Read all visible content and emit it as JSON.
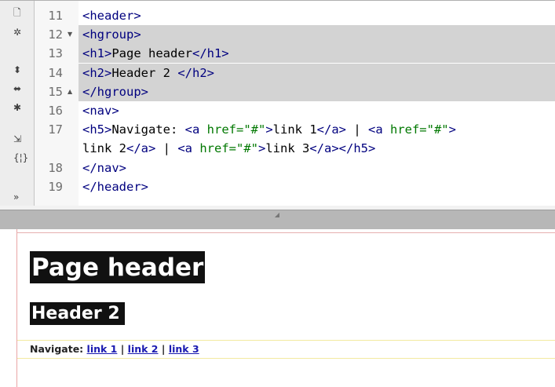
{
  "toolbar": {
    "icons": [
      "new-document-icon",
      "bug-icon",
      "collapse-tag-icon",
      "collapse-selection-icon",
      "expand-all-icon",
      "select-parent-tag-icon",
      "balance-braces-icon",
      "more-tools-icon"
    ],
    "glyphs": [
      "🗋",
      "✲",
      "⬍",
      "⬌",
      "✱",
      "⇲",
      "{¦}",
      "»"
    ]
  },
  "code_lines": [
    {
      "num": "11",
      "fold": "",
      "highlight": false,
      "parts": [
        {
          "t": "tag",
          "s": "<header>"
        }
      ]
    },
    {
      "num": "12",
      "fold": "▼",
      "highlight": true,
      "parts": [
        {
          "t": "tag",
          "s": "<hgroup>"
        }
      ]
    },
    {
      "num": "13",
      "fold": "",
      "highlight": true,
      "parts": [
        {
          "t": "tag",
          "s": "<h1>"
        },
        {
          "t": "txt",
          "s": "Page header"
        },
        {
          "t": "tag",
          "s": "</h1>"
        }
      ]
    },
    {
      "num": "14",
      "fold": "",
      "highlight": true,
      "parts": [
        {
          "t": "tag",
          "s": "<h2>"
        },
        {
          "t": "txt",
          "s": "Header 2 "
        },
        {
          "t": "tag",
          "s": "</h2>"
        }
      ]
    },
    {
      "num": "15",
      "fold": "▲",
      "highlight": true,
      "parts": [
        {
          "t": "tag",
          "s": "</hgroup>"
        }
      ]
    },
    {
      "num": "16",
      "fold": "",
      "highlight": false,
      "parts": [
        {
          "t": "tag",
          "s": "<nav>"
        }
      ]
    },
    {
      "num": "17",
      "fold": "",
      "highlight": false,
      "parts": [
        {
          "t": "tag",
          "s": "<h5>"
        },
        {
          "t": "txt",
          "s": "Navigate: "
        },
        {
          "t": "tag",
          "s": "<a "
        },
        {
          "t": "attr",
          "s": "href=\"#\""
        },
        {
          "t": "tag",
          "s": ">"
        },
        {
          "t": "txt",
          "s": "link 1"
        },
        {
          "t": "tag",
          "s": "</a>"
        },
        {
          "t": "txt",
          "s": " | "
        },
        {
          "t": "tag",
          "s": "<a "
        },
        {
          "t": "attr",
          "s": "href=\"#\""
        },
        {
          "t": "tag",
          "s": ">"
        }
      ]
    },
    {
      "num": "",
      "fold": "",
      "highlight": false,
      "parts": [
        {
          "t": "txt",
          "s": "link 2"
        },
        {
          "t": "tag",
          "s": "</a>"
        },
        {
          "t": "txt",
          "s": " | "
        },
        {
          "t": "tag",
          "s": "<a "
        },
        {
          "t": "attr",
          "s": "href=\"#\""
        },
        {
          "t": "tag",
          "s": ">"
        },
        {
          "t": "txt",
          "s": "link 3"
        },
        {
          "t": "tag",
          "s": "</a></h5>"
        }
      ]
    },
    {
      "num": "18",
      "fold": "",
      "highlight": false,
      "parts": [
        {
          "t": "tag",
          "s": "</nav>"
        }
      ]
    },
    {
      "num": "19",
      "fold": "",
      "highlight": false,
      "parts": [
        {
          "t": "tag",
          "s": "</header>"
        }
      ]
    }
  ],
  "preview": {
    "h1": "Page header",
    "h2": "Header 2",
    "nav_prefix": "Navigate:",
    "links": [
      "link 1",
      "link 2",
      "link 3"
    ],
    "separator": "|"
  },
  "colors": {
    "tag": "#00007f",
    "attr": "#007800",
    "highlight": "#d3d3d3",
    "heading_bg": "#111111",
    "link": "#1a1ab0"
  }
}
